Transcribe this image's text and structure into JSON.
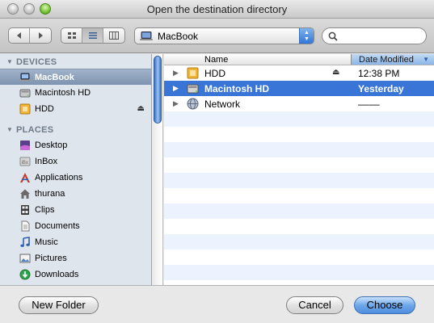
{
  "window": {
    "title": "Open the destination directory"
  },
  "toolbar": {
    "location": "MacBook",
    "search": {
      "value": "",
      "placeholder": ""
    }
  },
  "sidebar": {
    "devices_header": "DEVICES",
    "devices": [
      {
        "label": "MacBook",
        "icon": "laptop-icon",
        "selected": true
      },
      {
        "label": "Macintosh HD",
        "icon": "hard-drive-icon"
      },
      {
        "label": "HDD",
        "icon": "external-drive-icon",
        "eject": true
      }
    ],
    "places_header": "PLACES",
    "places": [
      {
        "label": "Desktop",
        "icon": "desktop-icon"
      },
      {
        "label": "InBox",
        "icon": "inbox-icon"
      },
      {
        "label": "Applications",
        "icon": "applications-icon"
      },
      {
        "label": "thurana",
        "icon": "home-icon"
      },
      {
        "label": "Clips",
        "icon": "clips-icon"
      },
      {
        "label": "Documents",
        "icon": "documents-icon"
      },
      {
        "label": "Music",
        "icon": "music-icon"
      },
      {
        "label": "Pictures",
        "icon": "pictures-icon"
      },
      {
        "label": "Downloads",
        "icon": "downloads-icon"
      }
    ]
  },
  "filelist": {
    "columns": {
      "name": "Name",
      "date": "Date Modified"
    },
    "rows": [
      {
        "name": "HDD",
        "date": "12:38 PM",
        "icon": "external-drive-icon",
        "eject": true
      },
      {
        "name": "Macintosh HD",
        "date": "Yesterday",
        "icon": "hard-drive-icon",
        "selected": true
      },
      {
        "name": "Network",
        "date": "––––",
        "icon": "network-icon"
      }
    ]
  },
  "buttons": {
    "new_folder": "New Folder",
    "cancel": "Cancel",
    "choose": "Choose"
  },
  "colors": {
    "selection": "#3875d7",
    "sidebar": "#dfe5ed",
    "row_alt": "#edf3fe"
  }
}
